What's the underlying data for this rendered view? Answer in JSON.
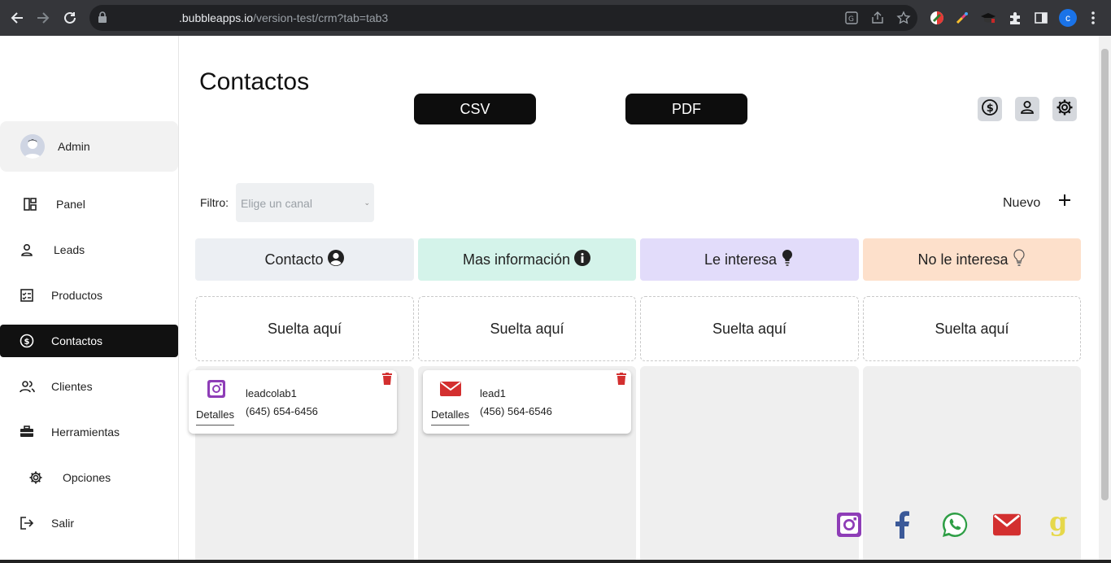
{
  "browser": {
    "url_host": ".bubbleapps.io",
    "url_path": "/version-test/crm?tab=tab3",
    "profile_initial": "c"
  },
  "sidebar": {
    "user_name": "Admin",
    "items": [
      {
        "label": "Panel",
        "icon": "dashboard-icon"
      },
      {
        "label": "Leads",
        "icon": "user-icon"
      },
      {
        "label": "Productos",
        "icon": "checklist-icon"
      },
      {
        "label": "Contactos",
        "icon": "dollar-circle-icon",
        "active": true
      },
      {
        "label": "Clientes",
        "icon": "users-icon"
      },
      {
        "label": "Herramientas",
        "icon": "toolbox-icon"
      },
      {
        "label": "Opciones",
        "icon": "gear-icon"
      },
      {
        "label": "Salir",
        "icon": "logout-icon"
      }
    ]
  },
  "page": {
    "title": "Contactos",
    "csv_label": "CSV",
    "pdf_label": "PDF",
    "filter_label": "Filtro:",
    "filter_placeholder": "Elige un canal",
    "new_label": "Nuevo"
  },
  "columns": [
    {
      "title": "Contacto",
      "color": "#eceff3",
      "icon": "person-circle-icon",
      "drop": "Suelta aquí"
    },
    {
      "title": "Mas información",
      "color": "#d4f3ea",
      "icon": "info-circle-icon",
      "drop": "Suelta aquí"
    },
    {
      "title": "Le interesa",
      "color": "#e2dcfa",
      "icon": "lightbulb-filled-icon",
      "drop": "Suelta aquí"
    },
    {
      "title": "No le interesa",
      "color": "#fde0cb",
      "icon": "lightbulb-outline-icon",
      "drop": "Suelta aquí"
    }
  ],
  "cards": [
    {
      "column": 0,
      "channel": "instagram-icon",
      "name": "leadcolab1",
      "phone": "(645) 654-6456",
      "details_label": "Detalles"
    },
    {
      "column": 1,
      "channel": "mail-icon",
      "name": "lead1",
      "phone": "(456) 564-6546",
      "details_label": "Detalles"
    }
  ],
  "colors": {
    "accent_dark": "#0d0d0d",
    "instagram": "#8e3db7",
    "facebook": "#3b5998",
    "whatsapp": "#2e9e45",
    "mail": "#d32f2f",
    "trash": "#d32f2f",
    "google": "#e6d84a"
  }
}
